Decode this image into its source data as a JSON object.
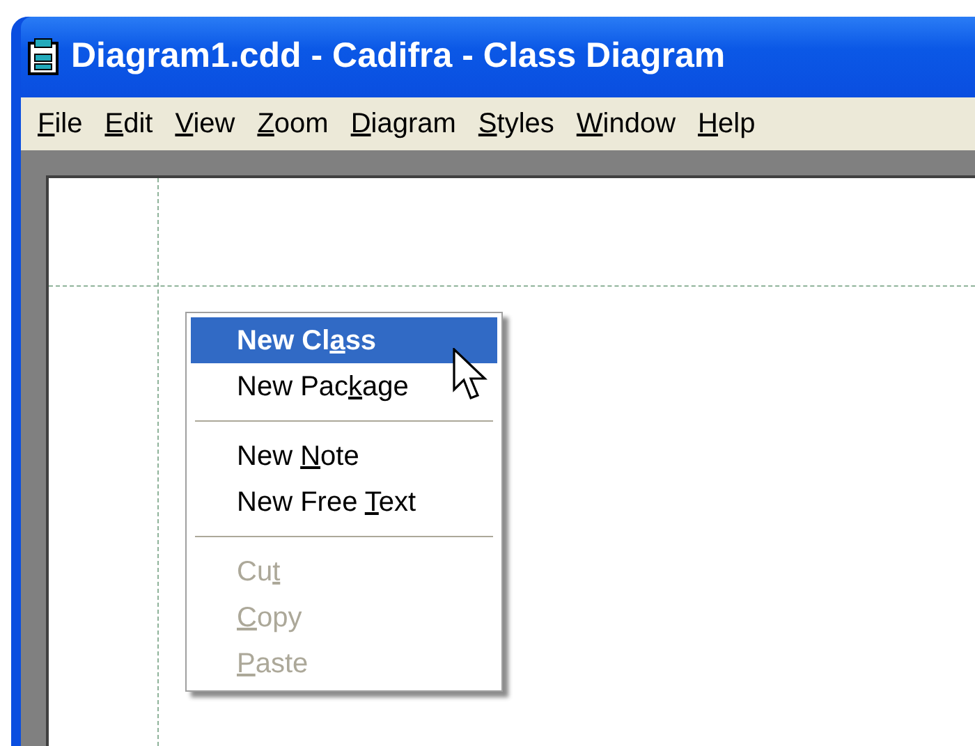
{
  "window": {
    "title": "Diagram1.cdd - Cadifra - Class Diagram"
  },
  "menu_bar": [
    {
      "key": "F",
      "post": "ile"
    },
    {
      "key": "E",
      "post": "dit"
    },
    {
      "key": "V",
      "post": "iew"
    },
    {
      "key": "Z",
      "post": "oom"
    },
    {
      "key": "D",
      "post": "iagram"
    },
    {
      "key": "S",
      "post": "tyles"
    },
    {
      "key": "W",
      "post": "indow"
    },
    {
      "key": "H",
      "post": "elp"
    }
  ],
  "context_menu": [
    {
      "kind": "item",
      "pre": "New Cl",
      "key": "a",
      "post": "ss",
      "selected": true,
      "disabled": false
    },
    {
      "kind": "item",
      "pre": "New Pac",
      "key": "k",
      "post": "age",
      "selected": false,
      "disabled": false
    },
    {
      "kind": "separator"
    },
    {
      "kind": "item",
      "pre": "New ",
      "key": "N",
      "post": "ote",
      "selected": false,
      "disabled": false
    },
    {
      "kind": "item",
      "pre": "New Free ",
      "key": "T",
      "post": "ext",
      "selected": false,
      "disabled": false
    },
    {
      "kind": "separator"
    },
    {
      "kind": "item",
      "pre": "Cu",
      "key": "t",
      "selected": false,
      "disabled": true
    },
    {
      "kind": "item",
      "key": "C",
      "post": "opy",
      "selected": false,
      "disabled": true
    },
    {
      "kind": "item",
      "key": "P",
      "post": "aste",
      "selected": false,
      "disabled": true
    }
  ]
}
